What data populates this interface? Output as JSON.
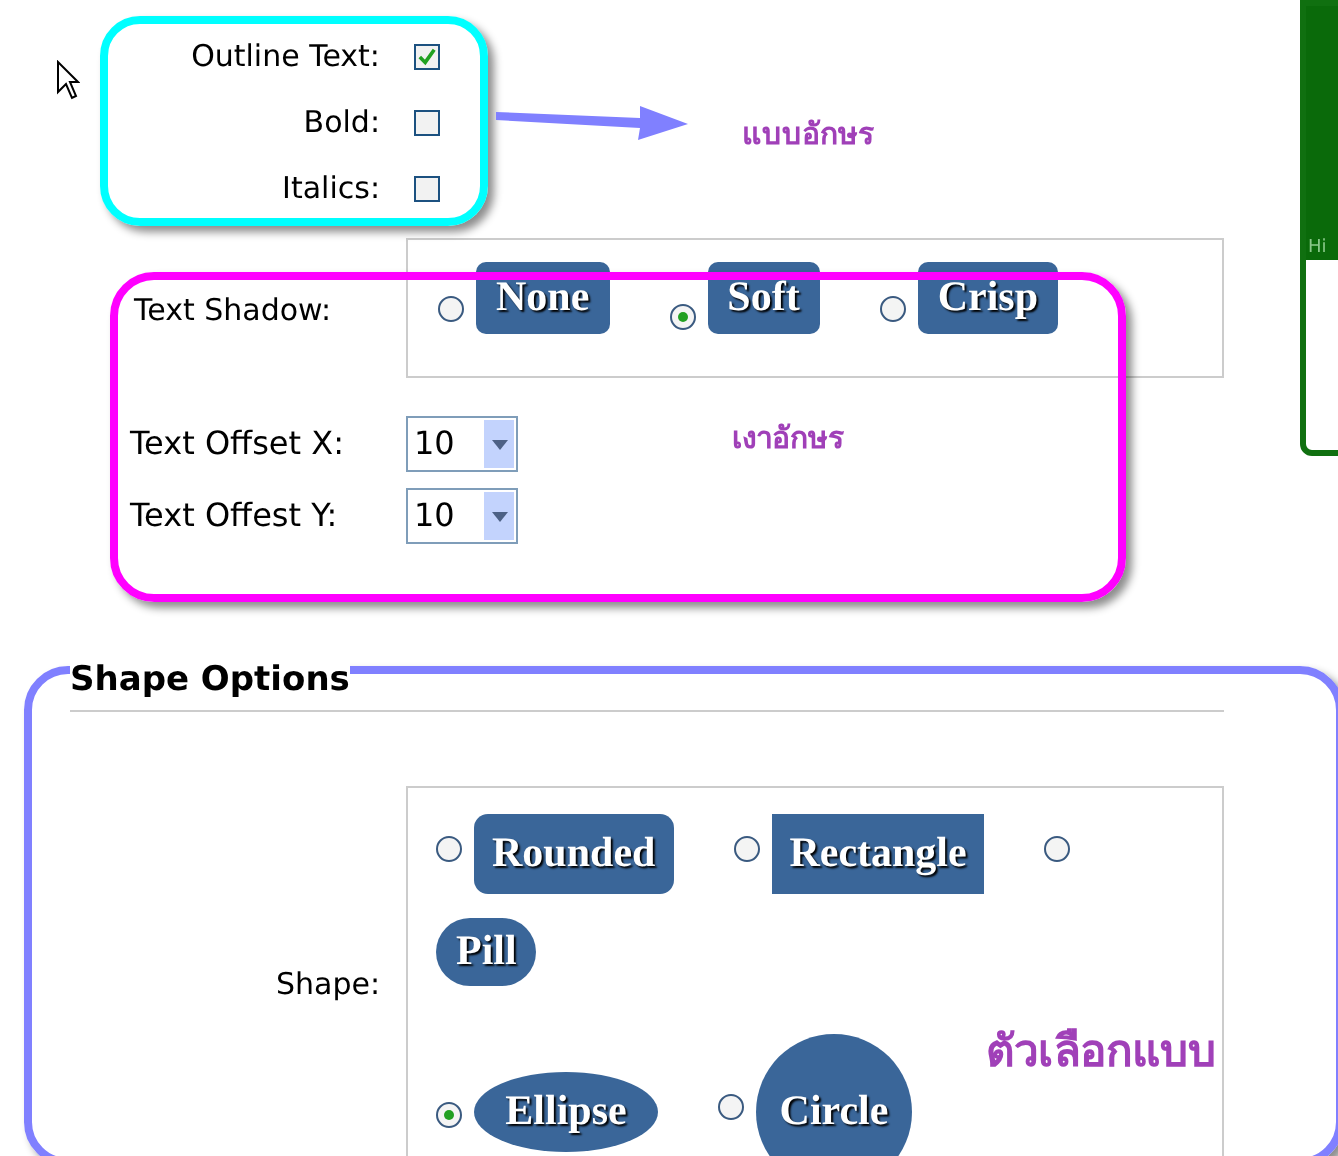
{
  "font_options": [
    {
      "label": "Outline Text:",
      "checked": true
    },
    {
      "label": "Bold:",
      "checked": false
    },
    {
      "label": "Italics:",
      "checked": false
    }
  ],
  "annotation_font": "แบบอักษร",
  "text_shadow": {
    "label": "Text Shadow:",
    "options": [
      {
        "label": "None",
        "selected": false
      },
      {
        "label": "Soft",
        "selected": true
      },
      {
        "label": "Crisp",
        "selected": false
      }
    ]
  },
  "offsets": [
    {
      "label": "Text Offset X:",
      "value": "10"
    },
    {
      "label": "Text Offest Y:",
      "value": "10"
    }
  ],
  "annotation_shadow": "เงาอักษร",
  "shape_options": {
    "heading": "Shape Options",
    "label": "Shape:",
    "options": [
      {
        "label": "Rounded",
        "kind": "rounded",
        "selected": false
      },
      {
        "label": "Rectangle",
        "kind": "rectangle",
        "selected": false
      },
      {
        "label": "Pill",
        "kind": "pill",
        "selected": false
      },
      {
        "label": "Ellipse",
        "kind": "ellipse",
        "selected": true
      },
      {
        "label": "Circle",
        "kind": "circle",
        "selected": false
      }
    ]
  },
  "annotation_shape": "ตัวเลือกแบบ",
  "side_panel": {
    "text": "Hi"
  }
}
